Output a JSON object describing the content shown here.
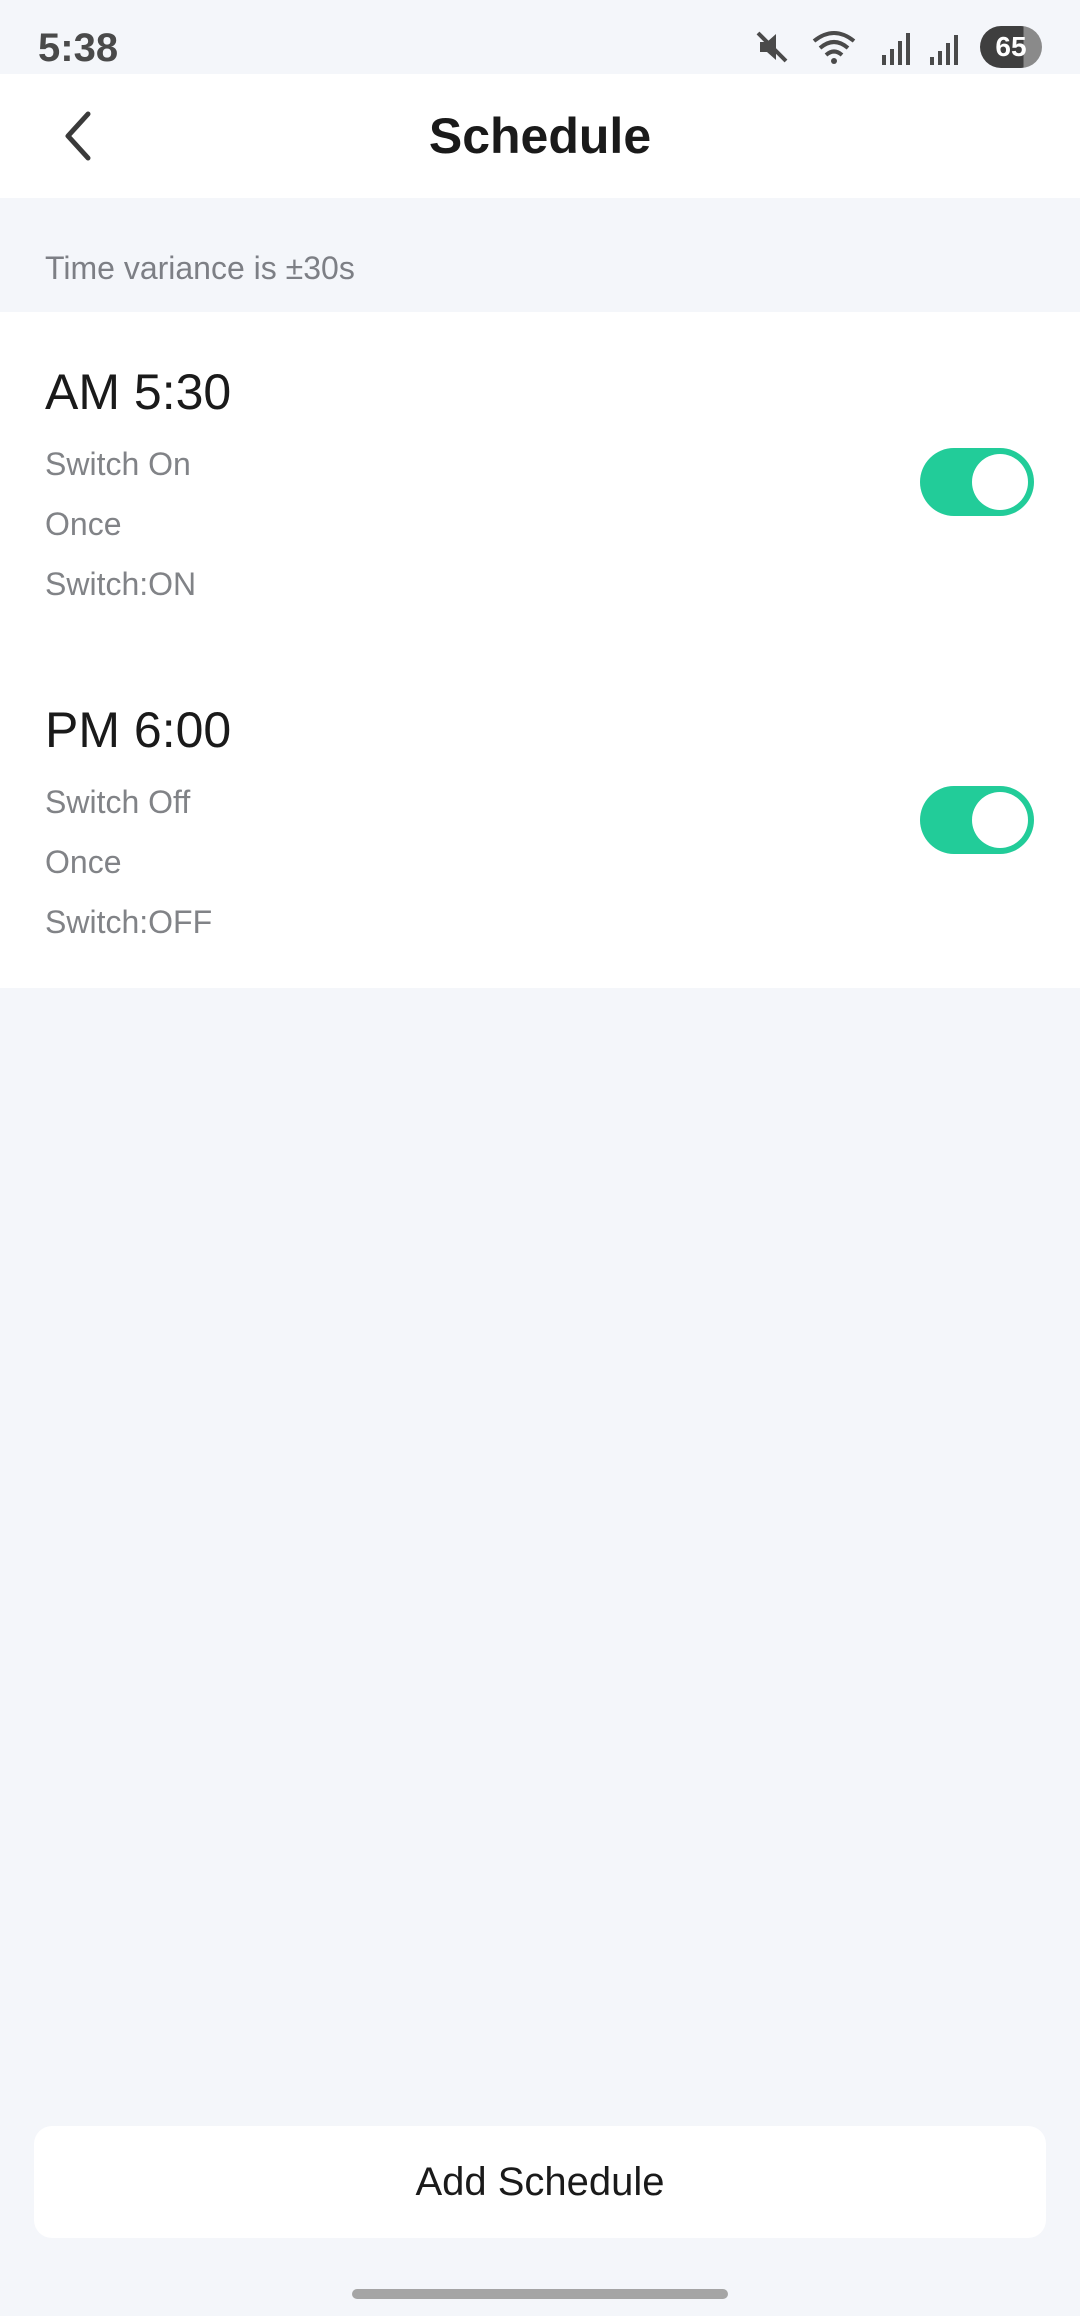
{
  "status_bar": {
    "time": "5:38",
    "battery": "65",
    "icons": [
      "mute-icon",
      "wifi-icon",
      "signal-roaming-icon",
      "signal-icon",
      "battery-icon"
    ]
  },
  "header": {
    "title": "Schedule",
    "back_icon": "chevron-left-icon"
  },
  "variance_note": "Time variance is ±30s",
  "schedules": [
    {
      "time": "AM 5:30",
      "action": "Switch On",
      "repeat": "Once",
      "state": "Switch:ON",
      "enabled": true
    },
    {
      "time": "PM 6:00",
      "action": "Switch Off",
      "repeat": "Once",
      "state": "Switch:OFF",
      "enabled": true
    }
  ],
  "add_button": {
    "label": "Add Schedule"
  },
  "colors": {
    "accent": "#22cc99",
    "background": "#f4f6fa",
    "card": "#ffffff"
  }
}
